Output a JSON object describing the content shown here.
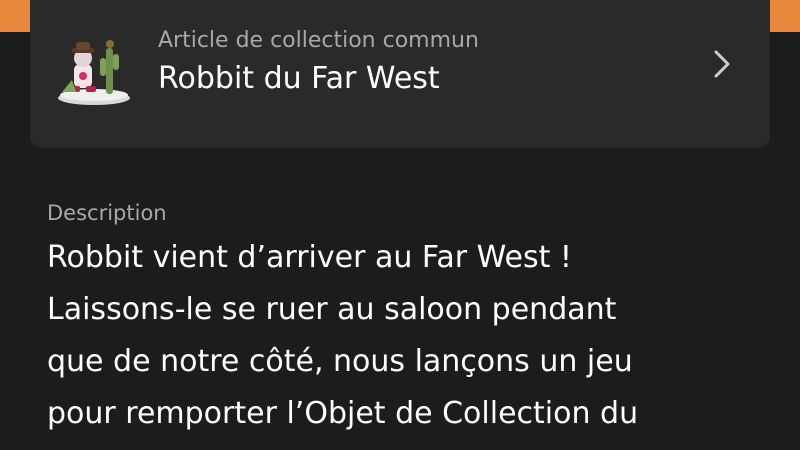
{
  "collectible": {
    "category": "Article de collection commun",
    "name": "Robbit du Far West",
    "thumbnail_icon": "collectible-figurine-thumbnail",
    "chevron_icon": "chevron-right-icon"
  },
  "description": {
    "label": "Description",
    "lines": [
      "Robbit vient d’arriver au Far West !",
      "Laissons-le se ruer au saloon pendant",
      "que de notre côté, nous lançons un jeu",
      "pour remporter l’Objet de Collection du"
    ]
  },
  "colors": {
    "background": "#1c1c1c",
    "card": "#2a2a2a",
    "accent": "#e8883c",
    "text_primary": "#ffffff",
    "text_secondary": "#a8a8a8"
  }
}
